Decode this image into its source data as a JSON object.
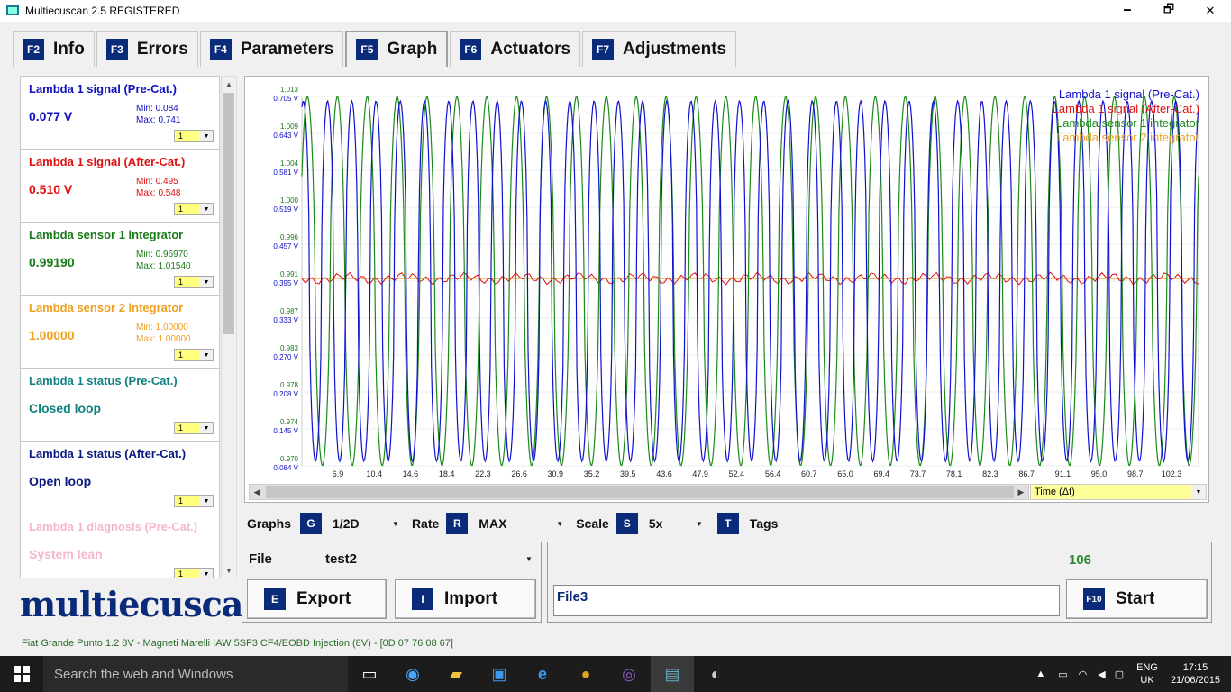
{
  "window": {
    "title": "Multiecuscan 2.5 REGISTERED",
    "minimize": "🗕",
    "maximize": "🗗",
    "close": "✕"
  },
  "tabs": [
    {
      "key": "F2",
      "label": "Info"
    },
    {
      "key": "F3",
      "label": "Errors"
    },
    {
      "key": "F4",
      "label": "Parameters"
    },
    {
      "key": "F5",
      "label": "Graph"
    },
    {
      "key": "F6",
      "label": "Actuators"
    },
    {
      "key": "F7",
      "label": "Adjustments"
    }
  ],
  "parameters": [
    {
      "name": "Lambda 1 signal (Pre-Cat.)",
      "value": "0.077 V",
      "min": "Min: 0.084",
      "max": "Max: 0.741",
      "scale": "1",
      "color": "#1010c0"
    },
    {
      "name": "Lambda 1 signal (After-Cat.)",
      "value": "0.510 V",
      "min": "Min: 0.495",
      "max": "Max: 0.548",
      "scale": "1",
      "color": "#e01010"
    },
    {
      "name": "Lambda sensor 1 integrator",
      "value": "0.99190",
      "min": "Min: 0.96970",
      "max": "Max: 1.01540",
      "scale": "1",
      "color": "#1a7a1a"
    },
    {
      "name": "Lambda sensor 2 integrator",
      "value": "1.00000",
      "min": "Min: 1.00000",
      "max": "Max: 1.00000",
      "scale": "1",
      "color": "#f0a020"
    },
    {
      "name": "Lambda 1 status (Pre-Cat.)",
      "value": "Closed loop",
      "min": "",
      "max": "",
      "scale": "1",
      "color": "#108080"
    },
    {
      "name": "Lambda 1 status (After-Cat.)",
      "value": "Open loop",
      "min": "",
      "max": "",
      "scale": "1",
      "color": "#0a1a80"
    },
    {
      "name": "Lambda 1 diagnosis (Pre-Cat.)",
      "value": "System lean",
      "min": "",
      "max": "",
      "scale": "1",
      "color": "#f4b8c8"
    }
  ],
  "logo": "multiecuscan",
  "chart_data": {
    "type": "line",
    "x_ticks": [
      "6.9",
      "10.4",
      "14.6",
      "18.4",
      "22.3",
      "26.6",
      "30.9",
      "35.2",
      "39.5",
      "43.6",
      "47.9",
      "52.4",
      "56.4",
      "60.7",
      "65.0",
      "69.4",
      "73.7",
      "78.1",
      "82.3",
      "86.7",
      "91.1",
      "95.0",
      "98.7",
      "102.3"
    ],
    "y_ticks_green": [
      "1.013",
      "1.009",
      "1.004",
      "1.000",
      "0.996",
      "0.991",
      "0.987",
      "0.983",
      "0.978",
      "0.974",
      "0.970"
    ],
    "y_ticks_blue": [
      "0.705 V",
      "0.643 V",
      "0.581 V",
      "0.519 V",
      "0.457 V",
      "0.395 V",
      "0.333 V",
      "0.270 V",
      "0.208 V",
      "0.145 V",
      "0.084 V"
    ],
    "xlabel": "Time (Δt)",
    "series": [
      {
        "name": "Lambda 1 signal (Pre-Cat.)",
        "color": "#1010d0",
        "cycles": 37,
        "min": 0.084,
        "max": 0.741
      },
      {
        "name": "Lambda 1 signal (After-Cat.)",
        "color": "#e01010",
        "cycles": 0,
        "min": 0.495,
        "max": 0.548
      },
      {
        "name": "Lambda sensor 1 integrator",
        "color": "#1a8a1a",
        "cycles": 30,
        "min": 0.9697,
        "max": 1.0154
      },
      {
        "name": "Lambda sensor 2 integrator",
        "color": "#f0a020",
        "cycles": 0,
        "min": 1.0,
        "max": 1.0
      }
    ]
  },
  "controls": {
    "graphs_label": "Graphs",
    "graphs_key": "G",
    "graphs_value": "1/2D",
    "rate_label": "Rate",
    "rate_key": "R",
    "rate_value": "MAX",
    "scale_label": "Scale",
    "scale_key": "S",
    "scale_value": "5x",
    "tags_key": "T",
    "tags_label": "Tags"
  },
  "file": {
    "label": "File",
    "value": "test2",
    "export_key": "E",
    "export_label": "Export",
    "import_key": "I",
    "import_label": "Import"
  },
  "record": {
    "counter": "106",
    "filename": "File3",
    "start_key": "F10",
    "start_label": "Start"
  },
  "status": "Fiat Grande Punto 1.2 8V - Magneti Marelli IAW 5SF3 CF4/EOBD Injection (8V) - [0D 07 76 08 67]",
  "taskbar": {
    "search": "Search the web and Windows",
    "lang1": "ENG",
    "lang2": "UK",
    "time": "17:15",
    "date": "21/06/2015"
  }
}
